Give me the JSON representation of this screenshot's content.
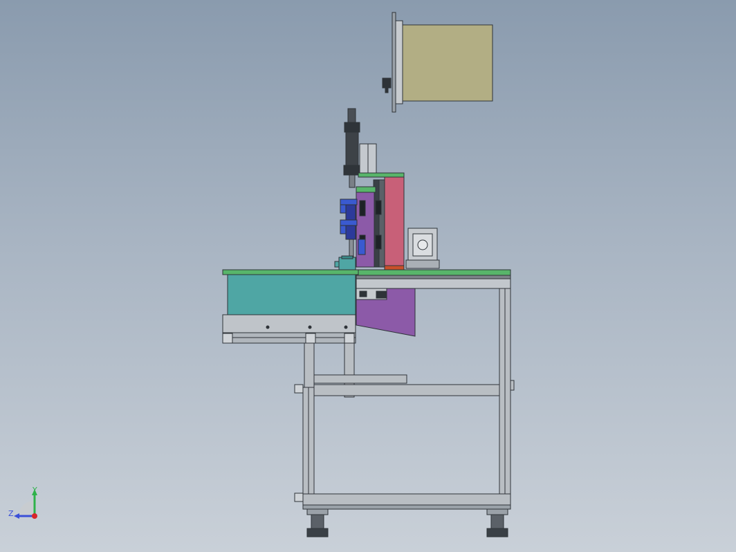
{
  "view": {
    "background_top": "#8a9bae",
    "background_bottom": "#c9d0d8"
  },
  "triad": {
    "y_label": "Y",
    "z_label": "Z",
    "y_color": "#2fb24a",
    "z_color": "#3a4fd8",
    "x_color": "#d8262a"
  },
  "colors": {
    "frame": "#b9bec3",
    "frame_edge": "#3a3f44",
    "hopper": "#4fa6a4",
    "plate_green": "#58b56a",
    "purple": "#8c5aa8",
    "pink": "#c86078",
    "blue": "#3a5ad0",
    "olive_box": "#b2ae84",
    "cylinder": "#3d4247"
  }
}
